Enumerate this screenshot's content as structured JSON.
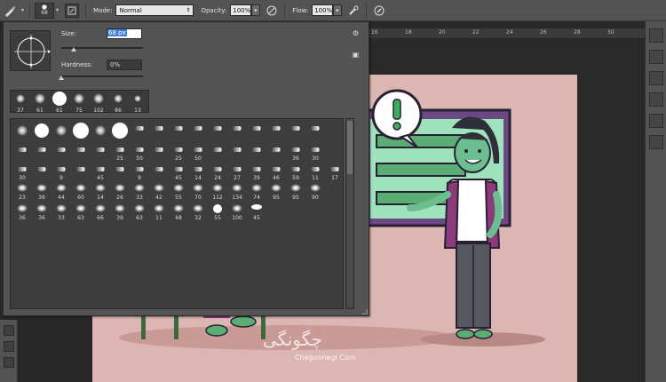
{
  "options_bar": {
    "brush_size_value": "68",
    "mode_label": "Mode:",
    "mode_value": "Normal",
    "opacity_label": "Opacity:",
    "opacity_value": "100%",
    "flow_label": "Flow:",
    "flow_value": "100%",
    "icons": [
      "brush-tool-icon",
      "brush-preset-icon",
      "toggle-brush-panel-icon",
      "pressure-opacity-icon",
      "airbrush-icon",
      "pressure-size-icon"
    ]
  },
  "picker": {
    "size_label": "Size:",
    "size_value": "68 px",
    "hardness_label": "Hardness:",
    "hardness_value": "0%",
    "size_fraction": 0.15,
    "hardness_fraction": 0.0,
    "recent_brushes": [
      "37",
      "61",
      "61",
      "75",
      "102",
      "86",
      "13"
    ],
    "grid_rows": [
      [
        "",
        "",
        "",
        "",
        "",
        "",
        "",
        "",
        "",
        "",
        "",
        "",
        "",
        "",
        "",
        ""
      ],
      [
        "",
        "",
        "",
        "",
        "",
        "25",
        "50",
        "",
        "25",
        "50",
        "",
        "",
        "",
        "",
        "36",
        "30"
      ],
      [
        "30",
        "",
        "9",
        "",
        "45",
        "",
        "9",
        "",
        "45",
        "14",
        "24",
        "27",
        "39",
        "46",
        "59",
        "11",
        "17"
      ],
      [
        "23",
        "36",
        "44",
        "60",
        "14",
        "26",
        "33",
        "42",
        "55",
        "70",
        "112",
        "134",
        "74",
        "95",
        "95",
        "90"
      ],
      [
        "36",
        "36",
        "33",
        "63",
        "66",
        "39",
        "63",
        "11",
        "48",
        "32",
        "55",
        "100",
        "45"
      ]
    ]
  },
  "ruler": {
    "ticks": [
      "16",
      "18",
      "20",
      "22",
      "24",
      "26",
      "28",
      "30"
    ]
  },
  "watermark": {
    "main": "چگونگی",
    "sub": "Chegoonegi.Com"
  }
}
